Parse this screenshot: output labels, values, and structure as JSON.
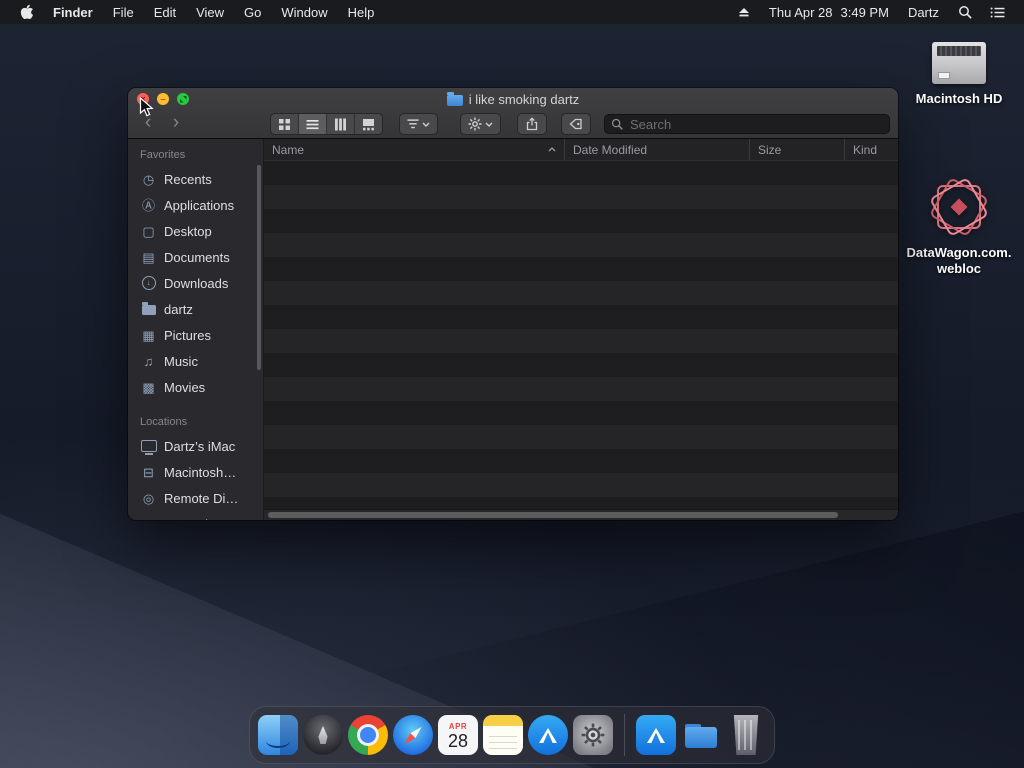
{
  "menu_bar": {
    "app_name": "Finder",
    "items": [
      "File",
      "Edit",
      "View",
      "Go",
      "Window",
      "Help"
    ],
    "status": {
      "date": "Thu Apr 28",
      "time": "3:49 PM",
      "user": "Dartz"
    }
  },
  "icons": {
    "back": "‹",
    "forward": "›",
    "recents": "◷",
    "applications": "Ⓐ",
    "desktop": "▢",
    "documents": "▤",
    "downloads_arrow": "↓",
    "pictures": "▦",
    "music": "♫",
    "movies": "▩",
    "hd": "⊟",
    "remote": "◎",
    "network": "⊕",
    "traffic_close": "×",
    "traffic_min": "–"
  },
  "window": {
    "title": "i like smoking dartz",
    "toolbar": {
      "search_placeholder": "Search"
    },
    "sidebar": {
      "sections": [
        {
          "label": "Favorites",
          "items": [
            {
              "label": "Recents"
            },
            {
              "label": "Applications"
            },
            {
              "label": "Desktop"
            },
            {
              "label": "Documents"
            },
            {
              "label": "Downloads"
            },
            {
              "label": "dartz"
            },
            {
              "label": "Pictures"
            },
            {
              "label": "Music"
            },
            {
              "label": "Movies"
            }
          ]
        },
        {
          "label": "Locations",
          "items": [
            {
              "label": "Dartz’s iMac"
            },
            {
              "label": "Macintosh…"
            },
            {
              "label": "Remote Di…"
            },
            {
              "label": "Network"
            }
          ]
        }
      ]
    },
    "list": {
      "columns": [
        "Name",
        "Date Modified",
        "Size",
        "Kind"
      ],
      "rows": []
    }
  },
  "desktop": {
    "icons": [
      {
        "label": "Macintosh HD"
      },
      {
        "label_line1": "DataWagon.com.",
        "label_line2": "webloc"
      }
    ]
  },
  "dock": {
    "calendar": {
      "month": "APR",
      "day": "28"
    },
    "items": [
      "finder",
      "launchpad",
      "chrome",
      "safari",
      "calendar",
      "notes",
      "app-store",
      "system-preferences",
      "app-store-alt",
      "downloads-folder",
      "trash"
    ]
  }
}
